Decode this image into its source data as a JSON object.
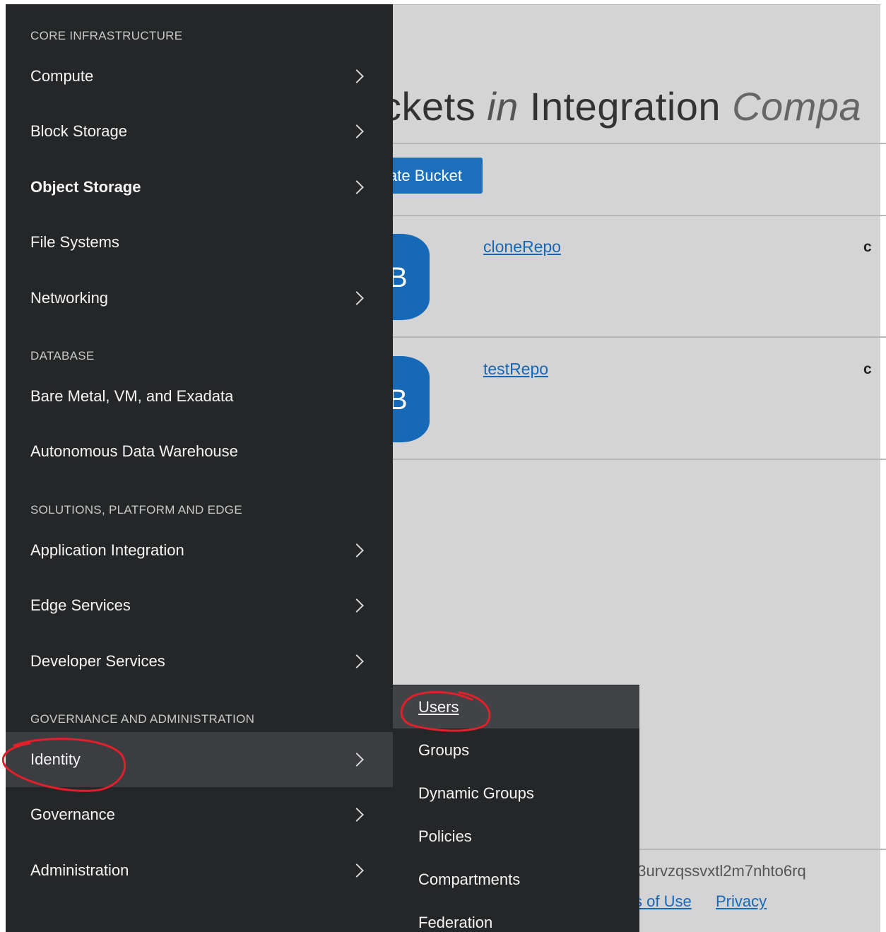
{
  "background": {
    "title_a": "ckets ",
    "title_in": "in",
    "title_b": " Integration ",
    "title_c": "Compa",
    "create_button": "ate Bucket",
    "buckets": [
      {
        "name": "cloneRepo",
        "icon_letter": "B",
        "col": "c"
      },
      {
        "name": "testRepo",
        "icon_letter": "B",
        "col": "c"
      }
    ],
    "footer_id": "63urvzqssvxtl2m7nhto6rq",
    "footer_terms": "s of Use",
    "footer_privacy": "Privacy"
  },
  "menu": {
    "sections": {
      "core": "CORE INFRASTRUCTURE",
      "database": "DATABASE",
      "solutions": "SOLUTIONS, PLATFORM AND EDGE",
      "governance": "GOVERNANCE AND ADMINISTRATION"
    },
    "items": [
      {
        "label": "Compute",
        "has_submenu": true
      },
      {
        "label": "Block Storage",
        "has_submenu": true
      },
      {
        "label": "Object Storage",
        "has_submenu": true,
        "current": true
      },
      {
        "label": "File Systems",
        "has_submenu": false
      },
      {
        "label": "Networking",
        "has_submenu": true
      },
      {
        "label": "Bare Metal, VM, and Exadata",
        "has_submenu": false
      },
      {
        "label": "Autonomous Data Warehouse",
        "has_submenu": false
      },
      {
        "label": "Application Integration",
        "has_submenu": true
      },
      {
        "label": "Edge Services",
        "has_submenu": true
      },
      {
        "label": "Developer Services",
        "has_submenu": true
      },
      {
        "label": "Identity",
        "has_submenu": true,
        "expanded": true
      },
      {
        "label": "Governance",
        "has_submenu": true
      },
      {
        "label": "Administration",
        "has_submenu": true
      }
    ]
  },
  "submenu": {
    "items": [
      {
        "label": "Users",
        "hovered": true
      },
      {
        "label": "Groups"
      },
      {
        "label": "Dynamic Groups"
      },
      {
        "label": "Policies"
      },
      {
        "label": "Compartments"
      },
      {
        "label": "Federation"
      }
    ]
  },
  "colors": {
    "menu_bg": "#242628",
    "menu_active_bg": "#3b3d40",
    "accent_blue": "#1c6fbd",
    "link_blue": "#1668b6",
    "annotation_red": "#e0202a"
  }
}
